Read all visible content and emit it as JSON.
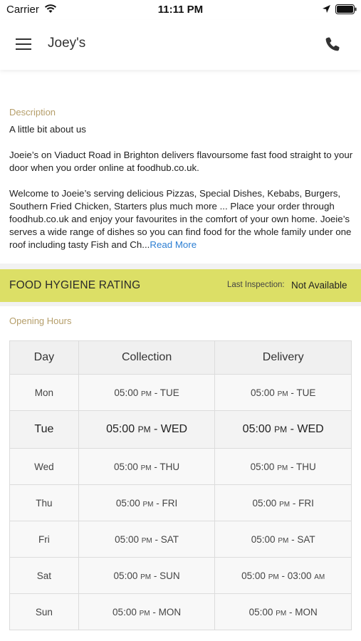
{
  "status_bar": {
    "carrier": "Carrier",
    "time": "11:11 PM"
  },
  "navbar": {
    "title": "Joey's"
  },
  "description": {
    "label": "Description",
    "heading": "A little bit about us",
    "paragraph1": "Joeie’s on Viaduct Road in Brighton delivers flavoursome fast food straight to your door when you order online at foodhub.co.uk.",
    "paragraph2": "Welcome to Joeie’s serving delicious Pizzas, Special Dishes, Kebabs, Burgers, Southern Fried Chicken, Starters plus much more ... Place your order through foodhub.co.uk and enjoy your favourites in the comfort of your own home. Joeie’s serves a wide range of dishes so you can find food for the whole family under one roof including tasty Fish and Ch...",
    "read_more": "Read More"
  },
  "hygiene": {
    "title": "FOOD HYGIENE RATING",
    "inspection_label": "Last Inspection:",
    "inspection_value": "Not Available",
    "bar_color": "#dcdf66"
  },
  "opening_hours": {
    "label": "Opening Hours",
    "headers": {
      "day": "Day",
      "collection": "Collection",
      "delivery": "Delivery"
    },
    "rows": [
      {
        "day": "Mon",
        "collection": {
          "from": "05:00",
          "from_ampm": "PM",
          "to": "TUE"
        },
        "delivery": {
          "from": "05:00",
          "from_ampm": "PM",
          "to": "TUE"
        }
      },
      {
        "day": "Tue",
        "collection": {
          "from": "05:00",
          "from_ampm": "PM",
          "to": "WED"
        },
        "delivery": {
          "from": "05:00",
          "from_ampm": "PM",
          "to": "WED"
        }
      },
      {
        "day": "Wed",
        "collection": {
          "from": "05:00",
          "from_ampm": "PM",
          "to": "THU"
        },
        "delivery": {
          "from": "05:00",
          "from_ampm": "PM",
          "to": "THU"
        }
      },
      {
        "day": "Thu",
        "collection": {
          "from": "05:00",
          "from_ampm": "PM",
          "to": "FRI"
        },
        "delivery": {
          "from": "05:00",
          "from_ampm": "PM",
          "to": "FRI"
        }
      },
      {
        "day": "Fri",
        "collection": {
          "from": "05:00",
          "from_ampm": "PM",
          "to": "SAT"
        },
        "delivery": {
          "from": "05:00",
          "from_ampm": "PM",
          "to": "SAT"
        }
      },
      {
        "day": "Sat",
        "collection": {
          "from": "05:00",
          "from_ampm": "PM",
          "to": "SUN"
        },
        "delivery": {
          "from": "05:00",
          "from_ampm": "PM",
          "to": "03:00",
          "to_ampm": "AM"
        }
      },
      {
        "day": "Sun",
        "collection": {
          "from": "05:00",
          "from_ampm": "PM",
          "to": "MON"
        },
        "delivery": {
          "from": "05:00",
          "from_ampm": "PM",
          "to": "MON"
        }
      }
    ],
    "highlighted_day": "Tue"
  }
}
